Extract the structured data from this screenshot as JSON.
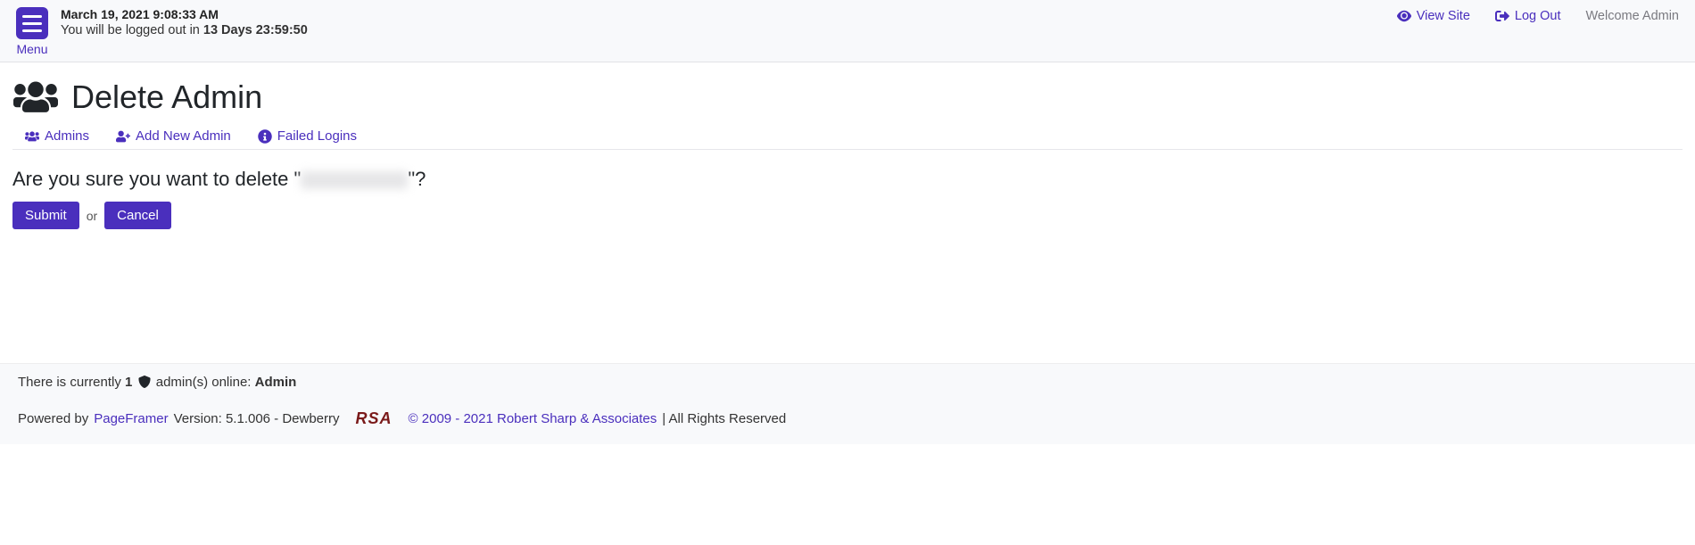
{
  "header": {
    "menu_label": "Menu",
    "datetime": "March 19, 2021 9:08:33 AM",
    "logout_prefix": "You will be logged out in ",
    "logout_value": "13 Days 23:59:50",
    "view_site": "View Site",
    "log_out": "Log Out",
    "welcome": "Welcome Admin"
  },
  "page": {
    "title": "Delete Admin",
    "nav": {
      "admins": "Admins",
      "add_new": "Add New Admin",
      "failed_logins": "Failed Logins"
    },
    "confirm_prefix": "Are you sure you want to delete \"",
    "confirm_suffix": "\"?",
    "submit": "Submit",
    "or": "or",
    "cancel": "Cancel"
  },
  "footer": {
    "online_prefix": "There is currently ",
    "online_count": "1",
    "online_mid": " admin(s) online: ",
    "online_name": "Admin",
    "powered_by": "Powered by ",
    "pageframer": "PageFramer",
    "version": " Version: 5.1.006 - Dewberry",
    "rsa": "RSA",
    "copyright": "© 2009 - 2021 Robert Sharp & Associates",
    "rights": " | All Rights Reserved"
  }
}
